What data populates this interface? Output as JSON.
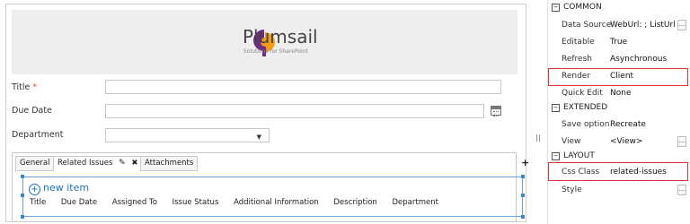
{
  "logo": {
    "name": "Plumsail",
    "tagline": "Solutions for SharePoint"
  },
  "fields": [
    {
      "label": "Title",
      "required_mark": "*"
    },
    {
      "label": "Due Date"
    },
    {
      "label": "Department"
    }
  ],
  "tabs": {
    "items": [
      {
        "label": "General"
      },
      {
        "label": "Related Issues"
      },
      {
        "label": "Attachments"
      }
    ],
    "edit_glyph": "✎",
    "close_glyph": "✖",
    "add_glyph": "+"
  },
  "list": {
    "new_item": "new item",
    "columns": [
      "Title",
      "Due Date",
      "Assigned To",
      "Issue Status",
      "Additional Information",
      "Description",
      "Department"
    ]
  },
  "properties": {
    "sections": [
      {
        "title": "COMMON",
        "sign": "⊟",
        "rows": [
          {
            "name": "Data Source",
            "value": "WebUrl: ; ListUrl",
            "ellipsis": "..."
          },
          {
            "name": "Editable",
            "value": "True"
          },
          {
            "name": "Refresh",
            "value": "Asynchronous"
          },
          {
            "name": "Render",
            "value": "Client"
          },
          {
            "name": "Quick Edit",
            "value": "None"
          }
        ]
      },
      {
        "title": "EXTENDED",
        "sign": "⊟",
        "rows": [
          {
            "name": "Save option",
            "value": "Recreate"
          },
          {
            "name": "View",
            "value": "<View>",
            "ellipsis": "..."
          }
        ]
      },
      {
        "title": "LAYOUT",
        "sign": "⊟",
        "rows": [
          {
            "name": "Css Class",
            "value": "related-issues"
          },
          {
            "name": "Style",
            "value": "",
            "ellipsis": "..."
          }
        ]
      }
    ]
  },
  "colors": {
    "highlight": "#e0332d",
    "accent": "#1a73c4",
    "logo_orange": "#f39c12",
    "logo_purple": "#6b2d82"
  }
}
